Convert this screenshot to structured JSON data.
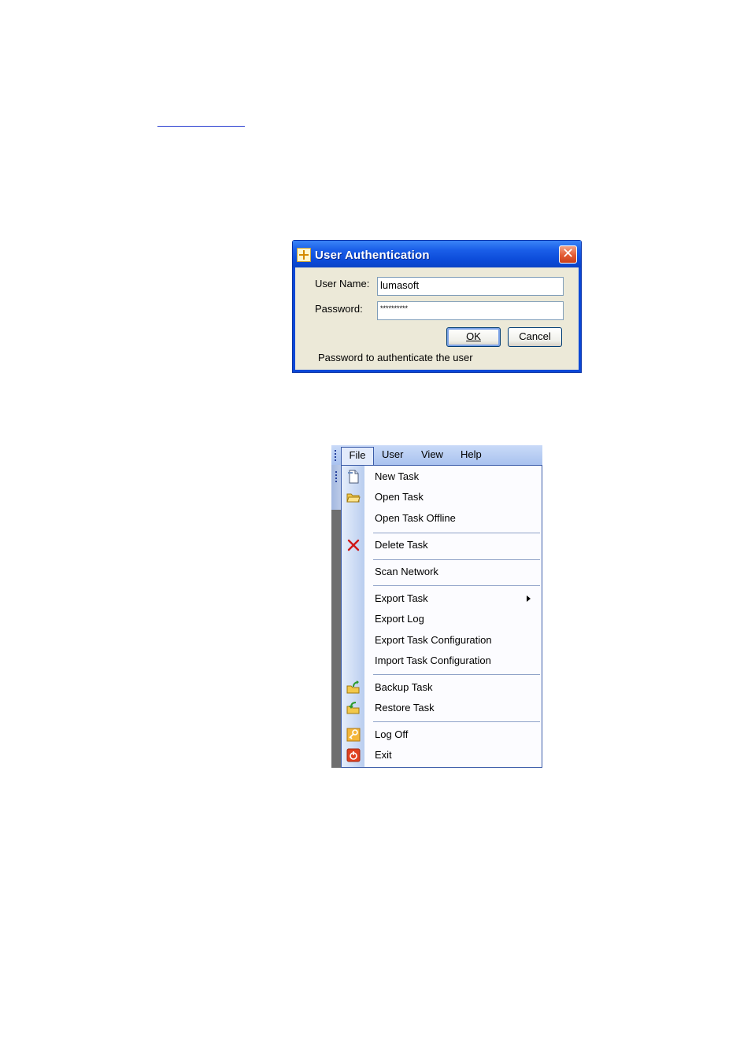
{
  "dialog": {
    "title": "User Authentication",
    "close_glyph": "✕",
    "username_label": "User Name:",
    "username_value": "lumasoft",
    "password_label": "Password:",
    "password_value": "**********",
    "ok_label": "OK",
    "cancel_label": "Cancel",
    "status": "Password to authenticate the user"
  },
  "menubar": {
    "items": [
      {
        "label": "File"
      },
      {
        "label": "User"
      },
      {
        "label": "View"
      },
      {
        "label": "Help"
      }
    ]
  },
  "file_menu": {
    "items": [
      {
        "label": "New Task",
        "icon": "new-document-icon"
      },
      {
        "label": "Open Task",
        "icon": "open-folder-icon"
      },
      {
        "label": "Open Task Offline"
      },
      {
        "label": "Delete Task",
        "icon": "delete-x-icon"
      },
      {
        "label": "Scan Network"
      },
      {
        "label": "Export Task",
        "submenu": true
      },
      {
        "label": "Export Log"
      },
      {
        "label": "Export Task Configuration"
      },
      {
        "label": "Import Task Configuration"
      },
      {
        "label": "Backup Task",
        "icon": "backup-folder-icon"
      },
      {
        "label": "Restore Task",
        "icon": "restore-folder-icon"
      },
      {
        "label": "Log Off",
        "icon": "key-icon"
      },
      {
        "label": "Exit",
        "icon": "power-icon"
      }
    ]
  },
  "colors": {
    "titlebar": "#0b4ad8",
    "dialog_body": "#ece9d8",
    "menubar": "#a9c2ef",
    "delete_icon": "#d01818",
    "exit_icon": "#e04020"
  }
}
